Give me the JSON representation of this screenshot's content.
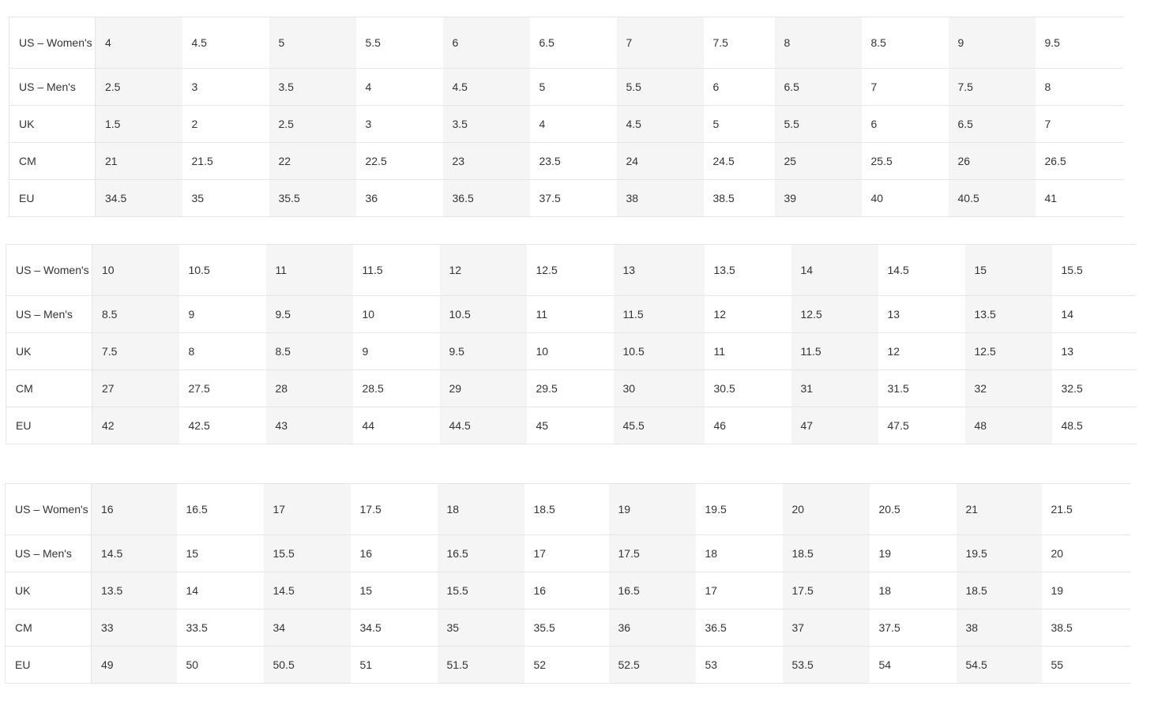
{
  "row_labels": [
    "US – Women's",
    "US – Men's",
    "UK",
    "CM",
    "EU"
  ],
  "tables": [
    {
      "rows": [
        [
          "4",
          "4.5",
          "5",
          "5.5",
          "6",
          "6.5",
          "7",
          "7.5",
          "8",
          "8.5",
          "9",
          "9.5"
        ],
        [
          "2.5",
          "3",
          "3.5",
          "4",
          "4.5",
          "5",
          "5.5",
          "6",
          "6.5",
          "7",
          "7.5",
          "8"
        ],
        [
          "1.5",
          "2",
          "2.5",
          "3",
          "3.5",
          "4",
          "4.5",
          "5",
          "5.5",
          "6",
          "6.5",
          "7"
        ],
        [
          "21",
          "21.5",
          "22",
          "22.5",
          "23",
          "23.5",
          "24",
          "24.5",
          "25",
          "25.5",
          "26",
          "26.5"
        ],
        [
          "34.5",
          "35",
          "35.5",
          "36",
          "36.5",
          "37.5",
          "38",
          "38.5",
          "39",
          "40",
          "40.5",
          "41"
        ]
      ]
    },
    {
      "rows": [
        [
          "10",
          "10.5",
          "11",
          "11.5",
          "12",
          "12.5",
          "13",
          "13.5",
          "14",
          "14.5",
          "15",
          "15.5"
        ],
        [
          "8.5",
          "9",
          "9.5",
          "10",
          "10.5",
          "11",
          "11.5",
          "12",
          "12.5",
          "13",
          "13.5",
          "14"
        ],
        [
          "7.5",
          "8",
          "8.5",
          "9",
          "9.5",
          "10",
          "10.5",
          "11",
          "11.5",
          "12",
          "12.5",
          "13"
        ],
        [
          "27",
          "27.5",
          "28",
          "28.5",
          "29",
          "29.5",
          "30",
          "30.5",
          "31",
          "31.5",
          "32",
          "32.5"
        ],
        [
          "42",
          "42.5",
          "43",
          "44",
          "44.5",
          "45",
          "45.5",
          "46",
          "47",
          "47.5",
          "48",
          "48.5"
        ]
      ]
    },
    {
      "rows": [
        [
          "16",
          "16.5",
          "17",
          "17.5",
          "18",
          "18.5",
          "19",
          "19.5",
          "20",
          "20.5",
          "21",
          "21.5"
        ],
        [
          "14.5",
          "15",
          "15.5",
          "16",
          "16.5",
          "17",
          "17.5",
          "18",
          "18.5",
          "19",
          "19.5",
          "20"
        ],
        [
          "13.5",
          "14",
          "14.5",
          "15",
          "15.5",
          "16",
          "16.5",
          "17",
          "17.5",
          "18",
          "18.5",
          "19"
        ],
        [
          "33",
          "33.5",
          "34",
          "34.5",
          "35",
          "35.5",
          "36",
          "36.5",
          "37",
          "37.5",
          "38",
          "38.5"
        ],
        [
          "49",
          "50",
          "50.5",
          "51",
          "51.5",
          "52",
          "52.5",
          "53",
          "53.5",
          "54",
          "54.5",
          "55"
        ]
      ]
    }
  ]
}
